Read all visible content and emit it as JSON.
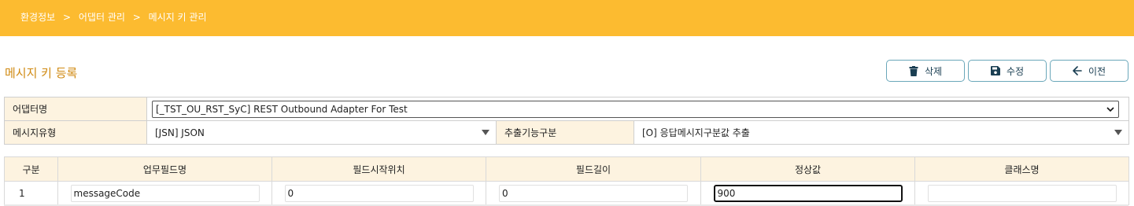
{
  "breadcrumb": {
    "items": [
      "환경정보",
      "어댑터 관리",
      "메시지 키 관리"
    ],
    "separator": ">"
  },
  "page": {
    "title": "메시지 키 등록"
  },
  "toolbar": {
    "delete_label": "삭제",
    "edit_label": "수정",
    "back_label": "이전"
  },
  "form": {
    "adapter_label": "어댑터명",
    "adapter_value": "[_TST_OU_RST_SyC] REST Outbound Adapter For Test",
    "message_type_label": "메시지유형",
    "message_type_value": "[JSN] JSON",
    "extract_label": "추출기능구분",
    "extract_value": "[O] 응답메시지구분값 추출"
  },
  "grid": {
    "headers": [
      "구분",
      "업무필드명",
      "필드시작위치",
      "필드길이",
      "정상값",
      "클래스명"
    ],
    "rows": [
      {
        "num": "1",
        "field_name": "messageCode",
        "start_pos": "0",
        "length": "0",
        "normal_value": "900",
        "class_name": ""
      }
    ]
  },
  "colors": {
    "header_bar": "#fcbb30",
    "title": "#d08a12",
    "button_border": "#6aa7ba",
    "label_bg": "#fdf3e0"
  },
  "icons": {
    "delete": "trash-icon",
    "edit": "save-icon",
    "back": "arrow-left-icon"
  }
}
